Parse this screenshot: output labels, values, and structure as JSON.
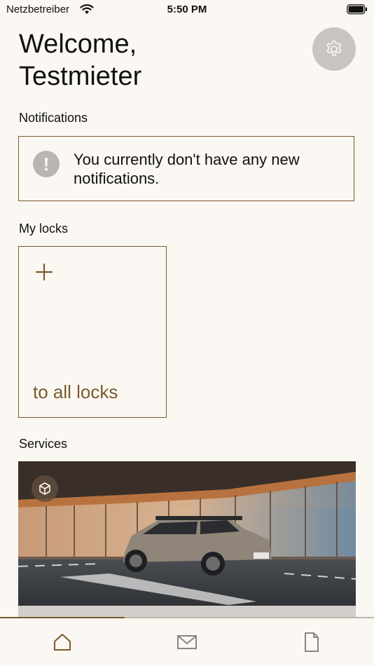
{
  "status_bar": {
    "carrier": "Netzbetreiber",
    "time": "5:50 PM",
    "icons": [
      "wifi-icon",
      "battery-icon"
    ]
  },
  "header": {
    "welcome_line1": "Welcome,",
    "welcome_line2": "Testmieter",
    "settings_icon": "gear-icon"
  },
  "notifications": {
    "title": "Notifications",
    "message": "You currently don't have any new notifications.",
    "icon": "exclamation-icon"
  },
  "locks": {
    "title": "My locks",
    "add_icon": "plus-icon",
    "card_label": "to all locks"
  },
  "services": {
    "title": "Services",
    "badge_icon": "cube-icon"
  },
  "tab_bar": {
    "active_tab": "home",
    "tabs": [
      {
        "id": "home",
        "icon": "home-icon"
      },
      {
        "id": "messages",
        "icon": "envelope-icon"
      },
      {
        "id": "documents",
        "icon": "document-icon"
      }
    ]
  },
  "colors": {
    "background": "#fbf8f3",
    "accent": "#7a5a2e",
    "muted_gray": "#b9b6b2"
  }
}
